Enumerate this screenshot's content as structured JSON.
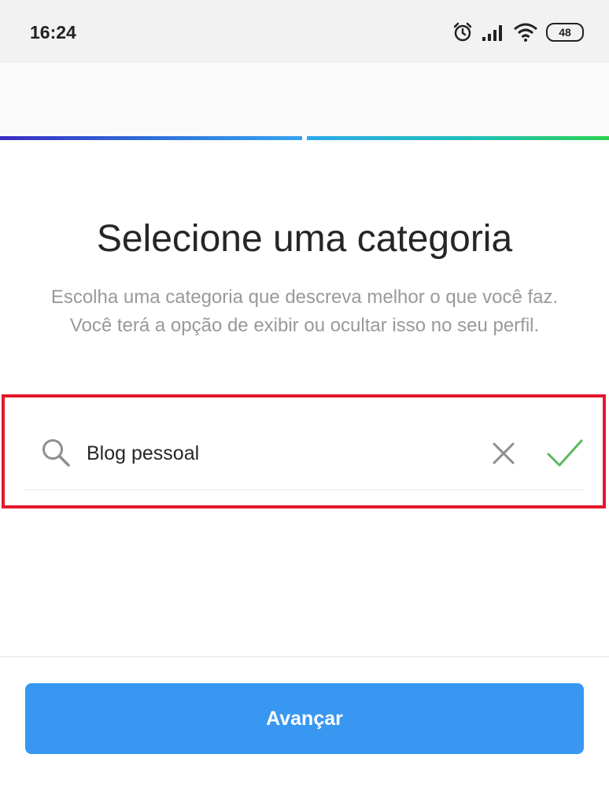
{
  "status_bar": {
    "time": "16:24",
    "battery": "48",
    "icons": [
      "alarm-icon",
      "signal-icon",
      "wifi-icon",
      "battery-icon"
    ]
  },
  "page": {
    "title": "Selecione uma categoria",
    "subtitle": "Escolha uma categoria que descreva melhor o que você faz. Você terá a opção de exibir ou ocultar isso no seu perfil."
  },
  "progress": {
    "steps_total": 2,
    "steps_done": 2
  },
  "search": {
    "value": "Blog pessoal",
    "icon": "search-icon",
    "clear_icon": "close-icon",
    "confirm_icon": "check-icon"
  },
  "footer": {
    "next_label": "Avançar"
  },
  "colors": {
    "accent": "#3897f0",
    "highlight": "#e3182a",
    "confirm": "#5cb85c"
  }
}
